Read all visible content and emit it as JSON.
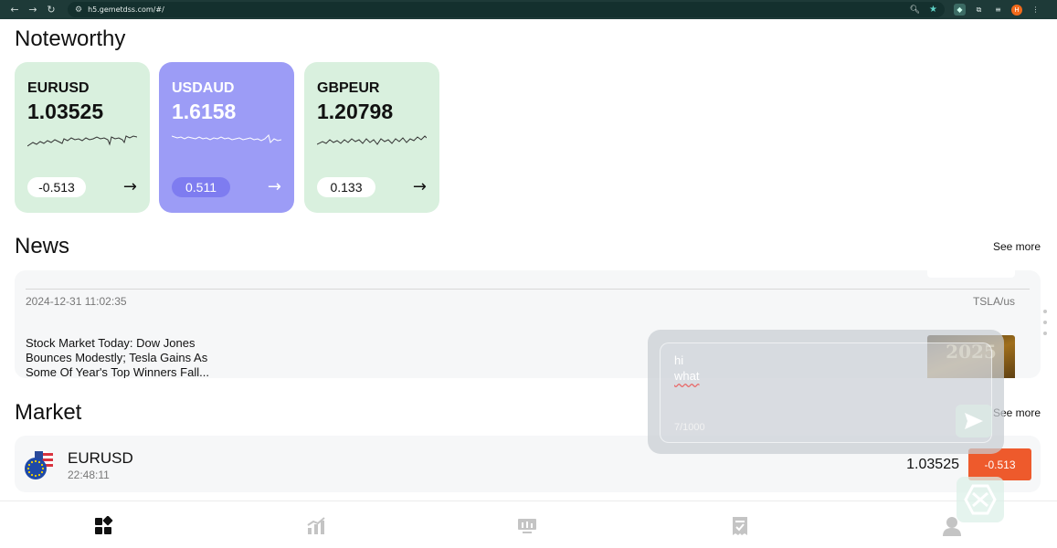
{
  "browser": {
    "url": "h5.gemetdss.com/#/",
    "profile_initial": "H"
  },
  "noteworthy": {
    "title": "Noteworthy",
    "cards": [
      {
        "symbol": "EURUSD",
        "price": "1.03525",
        "change": "-0.513",
        "theme": "green"
      },
      {
        "symbol": "USDAUD",
        "price": "1.6158",
        "change": "0.511",
        "theme": "purple"
      },
      {
        "symbol": "GBPEUR",
        "price": "1.20798",
        "change": "0.133",
        "theme": "green"
      }
    ],
    "arrow": "→"
  },
  "news": {
    "title": "News",
    "see_more": "See more",
    "item": {
      "date": "2024-12-31 11:02:35",
      "tag": "TSLA/us",
      "headline": "Stock Market Today: Dow Jones Bounces Modestly; Tesla Gains As Some Of Year's Top Winners Fall...",
      "thumb_text": "2025"
    }
  },
  "market": {
    "title": "Market",
    "see_more": "See more",
    "rows": [
      {
        "symbol": "EURUSD",
        "time": "22:48:11",
        "price": "1.03525",
        "change": "-0.513"
      }
    ]
  },
  "chat_overlay": {
    "line1": "hi",
    "line2": "what",
    "counter": "7/1000"
  },
  "bottom_nav": {
    "items": [
      {
        "icon": "home-icon",
        "active": true
      },
      {
        "icon": "chart-icon",
        "active": false
      },
      {
        "icon": "trading-icon",
        "active": false
      },
      {
        "icon": "orders-icon",
        "active": false
      },
      {
        "icon": "profile-icon",
        "active": false
      }
    ]
  },
  "colors": {
    "card_green": "#d9f0de",
    "card_purple": "#9c9cf6",
    "negative": "#ee5a2c",
    "browser_bar": "#1e3a38"
  }
}
